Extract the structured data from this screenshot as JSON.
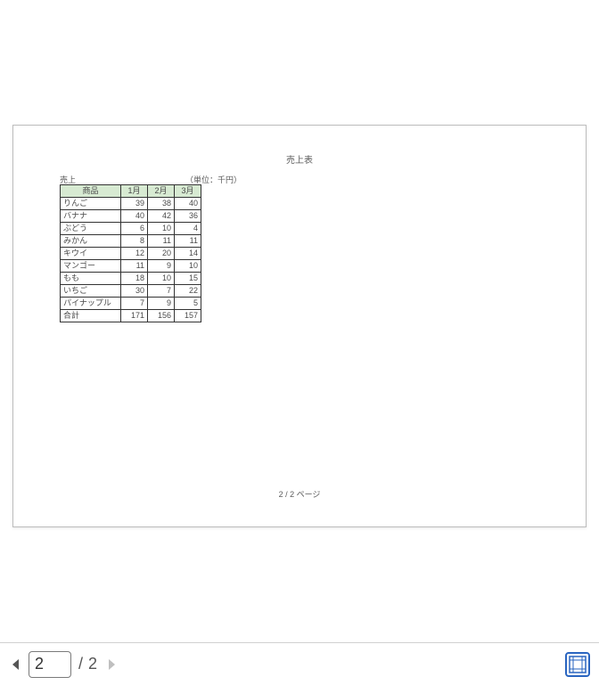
{
  "document": {
    "title": "売上表",
    "top_label": "売上",
    "unit_label": "（単位：千円）",
    "footer": "2 / 2 ページ"
  },
  "table": {
    "headers": [
      "商品",
      "1月",
      "2月",
      "3月"
    ],
    "rows": [
      {
        "name": "りんご",
        "m1": "39",
        "m2": "38",
        "m3": "40"
      },
      {
        "name": "バナナ",
        "m1": "40",
        "m2": "42",
        "m3": "36"
      },
      {
        "name": "ぶどう",
        "m1": "6",
        "m2": "10",
        "m3": "4"
      },
      {
        "name": "みかん",
        "m1": "8",
        "m2": "11",
        "m3": "11"
      },
      {
        "name": "キウイ",
        "m1": "12",
        "m2": "20",
        "m3": "14"
      },
      {
        "name": "マンゴー",
        "m1": "11",
        "m2": "9",
        "m3": "10"
      },
      {
        "name": "もも",
        "m1": "18",
        "m2": "10",
        "m3": "15"
      },
      {
        "name": "いちご",
        "m1": "30",
        "m2": "7",
        "m3": "22"
      },
      {
        "name": "パイナップル",
        "m1": "7",
        "m2": "9",
        "m3": "5"
      }
    ],
    "total": {
      "name": "合計",
      "m1": "171",
      "m2": "156",
      "m3": "157"
    }
  },
  "toolbar": {
    "current_page": "2",
    "total_pages": "2",
    "separator": "/"
  },
  "colors": {
    "header_bg": "#d7ead2",
    "accent": "#2a65c0"
  }
}
